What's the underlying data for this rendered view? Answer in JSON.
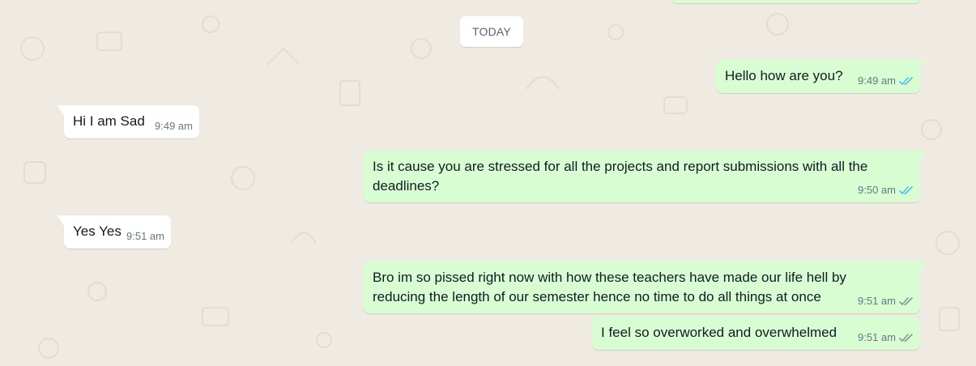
{
  "conversation": {
    "date_chip": "TODAY",
    "messages": [
      {
        "direction": "out",
        "text": "Hello how are you?",
        "time": "9:49 am",
        "status": "read",
        "ticks": "double-check-icon"
      },
      {
        "direction": "in",
        "text": "Hi I am Sad",
        "time": "9:49 am"
      },
      {
        "direction": "out",
        "text": "Is it cause you are stressed for all the projects and report submissions with all the deadlines?",
        "time": "9:50 am",
        "status": "read",
        "ticks": "double-check-icon"
      },
      {
        "direction": "in",
        "text": "Yes Yes",
        "time": "9:51 am"
      },
      {
        "direction": "out",
        "text": "Bro im so pissed right now with how these teachers have made our life hell by reducing the length of our semester hence no time to do all things at once",
        "time": "9:51 am",
        "status": "delivered",
        "ticks": "double-check-icon"
      },
      {
        "direction": "out",
        "text": "I feel so overworked and overwhelmed",
        "time": "9:51 am",
        "status": "delivered",
        "ticks": "double-check-icon"
      }
    ]
  },
  "colors": {
    "chat_background": "#efeae2",
    "incoming_bubble": "#ffffff",
    "outgoing_bubble": "#d9fdd3",
    "read_ticks": "#53bdeb",
    "delivered_ticks": "#8696a0",
    "timestamp": "#667781"
  }
}
